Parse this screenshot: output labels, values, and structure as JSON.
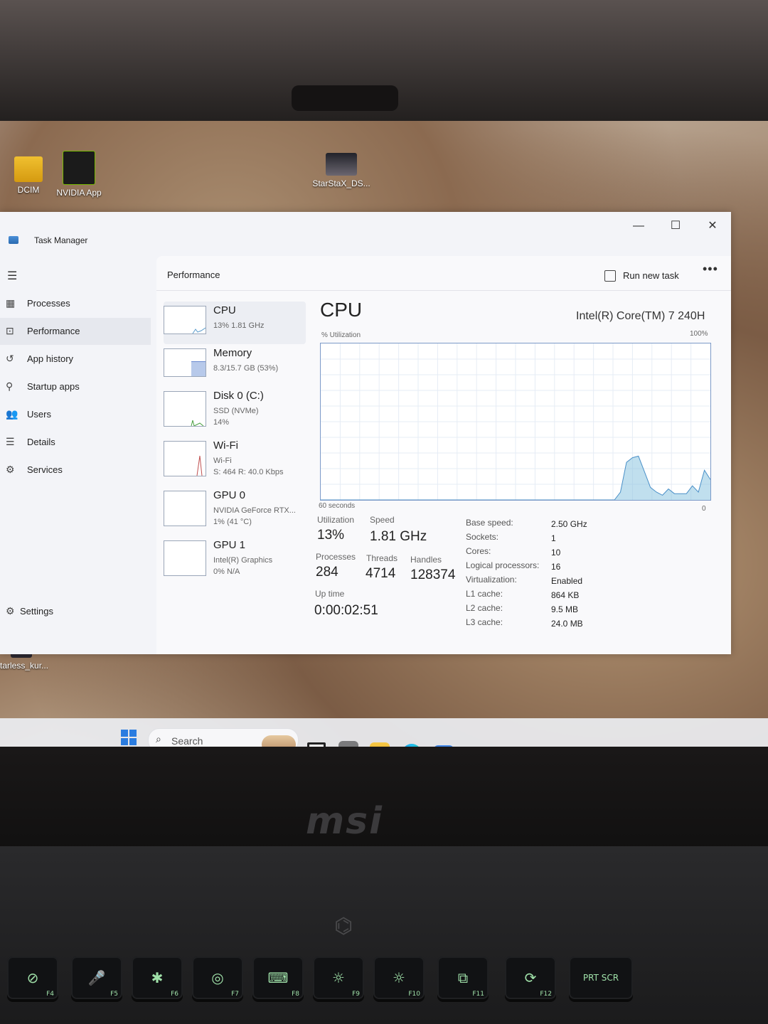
{
  "desktop": {
    "icons": [
      {
        "name": "dcim-folder",
        "label": "DCIM"
      },
      {
        "name": "nvidia-app",
        "label": "NVIDIA App"
      },
      {
        "name": "starstax",
        "label": "StarStaX_DS..."
      },
      {
        "name": "starless",
        "label": "tarless_kur..."
      }
    ]
  },
  "window": {
    "title": "Task Manager",
    "controls": {
      "minimize": "—",
      "maximize": "☐",
      "close": "✕"
    }
  },
  "nav": {
    "items": [
      {
        "label": "Processes",
        "icon": "processes-icon"
      },
      {
        "label": "Performance",
        "icon": "performance-icon"
      },
      {
        "label": "App history",
        "icon": "history-icon"
      },
      {
        "label": "Startup apps",
        "icon": "startup-icon"
      },
      {
        "label": "Users",
        "icon": "users-icon"
      },
      {
        "label": "Details",
        "icon": "details-icon"
      },
      {
        "label": "Services",
        "icon": "services-icon"
      }
    ],
    "settings": "Settings",
    "active": "Performance"
  },
  "header": {
    "title": "Performance",
    "run_new_task": "Run new task",
    "more": "•••"
  },
  "devices": [
    {
      "name": "CPU",
      "line1": "13%  1.81 GHz",
      "line2": ""
    },
    {
      "name": "Memory",
      "line1": "8.3/15.7 GB (53%)",
      "line2": ""
    },
    {
      "name": "Disk 0 (C:)",
      "line1": "SSD (NVMe)",
      "line2": "14%"
    },
    {
      "name": "Wi-Fi",
      "line1": "Wi-Fi",
      "line2": "S: 464  R: 40.0 Kbps"
    },
    {
      "name": "GPU 0",
      "line1": "NVIDIA GeForce RTX...",
      "line2": "1%  (41 °C)"
    },
    {
      "name": "GPU 1",
      "line1": "Intel(R) Graphics",
      "line2": "0%  N/A"
    }
  ],
  "cpu": {
    "title": "CPU",
    "model": "Intel(R) Core(TM) 7 240H",
    "utilization_label": "% Utilization",
    "max_label": "100%",
    "time_label": "60 seconds",
    "min_label": "0",
    "graph_color": "#8cc4e0",
    "utilization_history": [
      0,
      0,
      0,
      0,
      0,
      0,
      0,
      0,
      0,
      0,
      0,
      0,
      0,
      0,
      0,
      0,
      0,
      0,
      0,
      0,
      0,
      0,
      0,
      0,
      0,
      0,
      0,
      0,
      0,
      0,
      0,
      0,
      0,
      0,
      0,
      0,
      0,
      0,
      0,
      0,
      0,
      0,
      0,
      0,
      0,
      0,
      0,
      0,
      0,
      0,
      5,
      24,
      27,
      28,
      18,
      8,
      5,
      3,
      7,
      4,
      4,
      4,
      9,
      5,
      19,
      13
    ]
  },
  "stats": {
    "utilization_label": "Utilization",
    "utilization": "13%",
    "speed_label": "Speed",
    "speed": "1.81 GHz",
    "processes_label": "Processes",
    "processes": "284",
    "threads_label": "Threads",
    "threads": "4714",
    "handles_label": "Handles",
    "handles": "128374",
    "uptime_label": "Up time",
    "uptime": "0:00:02:51"
  },
  "specs": [
    {
      "label": "Base speed:",
      "value": "2.50 GHz"
    },
    {
      "label": "Sockets:",
      "value": "1"
    },
    {
      "label": "Cores:",
      "value": "10"
    },
    {
      "label": "Logical processors:",
      "value": "16"
    },
    {
      "label": "Virtualization:",
      "value": "Enabled"
    },
    {
      "label": "L1 cache:",
      "value": "864 KB"
    },
    {
      "label": "L2 cache:",
      "value": "9.5 MB"
    },
    {
      "label": "L3 cache:",
      "value": "24.0 MB"
    }
  ],
  "taskbar": {
    "search_placeholder": "Search",
    "apps": [
      "widgets",
      "task-view",
      "app-gray",
      "file-explorer",
      "edge",
      "store",
      "photos",
      "xbox",
      "telegram",
      "whatsapp",
      "task-manager"
    ]
  },
  "laptop": {
    "brand": "msi",
    "keys": [
      {
        "label": "⊘",
        "fn": "F4"
      },
      {
        "label": "🎤",
        "fn": "F5"
      },
      {
        "label": "✱",
        "fn": "F6"
      },
      {
        "label": "◎",
        "fn": "F7"
      },
      {
        "label": "⌨",
        "fn": "F8"
      },
      {
        "label": "☼",
        "fn": "F9"
      },
      {
        "label": "☼",
        "fn": "F10"
      },
      {
        "label": "⧉",
        "fn": "F11"
      },
      {
        "label": "⟳",
        "fn": "F12"
      },
      {
        "label": "PRT SCR",
        "fn": ""
      }
    ]
  }
}
